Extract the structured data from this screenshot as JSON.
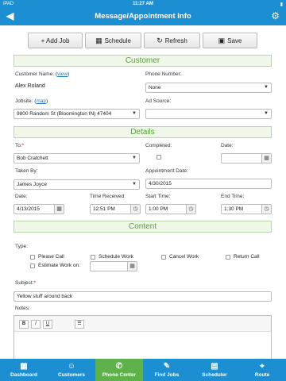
{
  "status": {
    "carrier": "iPAD",
    "time": "11:27 AM",
    "battery": "▮"
  },
  "nav": {
    "title": "Message/Appointment Info",
    "back_icon": "back-arrow-icon",
    "settings_icon": "gear-icon"
  },
  "toolbar": {
    "add_job": "+ Add Job",
    "schedule": "Schedule",
    "refresh": "Refresh",
    "save": "Save"
  },
  "customer": {
    "section": "Customer",
    "name_label": "Customer Name: (",
    "name_link": "view",
    "name_label_end": ")",
    "name_value": "Alex Roland",
    "phone_label": "Phone Number:",
    "phone_value": "None",
    "jobsite_label": "Jobsite: (",
    "jobsite_link": "map",
    "jobsite_label_end": ")",
    "jobsite_value": "9800 Random St (Bloomington IN) 47404",
    "adsource_label": "Ad Source:",
    "adsource_value": ""
  },
  "details": {
    "section": "Details",
    "to_label": "To:",
    "to_req": "*",
    "to_value": "Bob Cratchett",
    "completed_label": "Completed:",
    "date_label": "Date:",
    "date_value": "",
    "takenby_label": "Taken By:",
    "takenby_value": "James Joyce",
    "appt_date_label": "Appointment Date:",
    "appt_date_value": "4/30/2015",
    "date2_label": "Date:",
    "date2_value": "4/13/2015",
    "time_received_label": "Time Received:",
    "time_received_value": "12:51 PM",
    "start_label": "Start Time:",
    "start_value": "1:00 PM",
    "end_label": "End Time:",
    "end_value": "1:30 PM"
  },
  "content": {
    "section": "Content",
    "type_label": "Type:",
    "types": [
      "Please Call",
      "Schedule Work",
      "Cancel Work",
      "Return Call"
    ],
    "estimate_label": "Estimate Work on:",
    "estimate_value": "",
    "subject_label": "Subject:",
    "subject_req": "*",
    "subject_value": "Yellow stuff around back",
    "notes_label": "Notes:",
    "editor": {
      "bold": "B",
      "italic": "I",
      "underline": "U",
      "list": "☰"
    }
  },
  "tabs": [
    {
      "label": "Dashboard",
      "icon": "dashboard-icon",
      "glyph": "▦",
      "active": false
    },
    {
      "label": "Customers",
      "icon": "person-icon",
      "glyph": "☺",
      "active": false
    },
    {
      "label": "Phone Center",
      "icon": "phone-icon",
      "glyph": "✆",
      "active": true
    },
    {
      "label": "Find Jobs",
      "icon": "edit-icon",
      "glyph": "✎",
      "active": false
    },
    {
      "label": "Scheduler",
      "icon": "calendar-icon",
      "glyph": "▤",
      "active": false
    },
    {
      "label": "Route",
      "icon": "map-pin-icon",
      "glyph": "⌖",
      "active": false
    }
  ]
}
